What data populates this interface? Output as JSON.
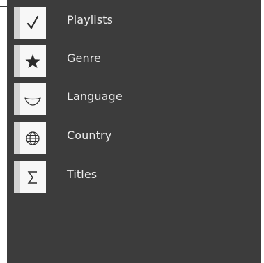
{
  "menu": {
    "items": [
      {
        "label": "Playlists",
        "icon": "checkmark-icon"
      },
      {
        "label": "Genre",
        "icon": "star-icon"
      },
      {
        "label": "Language",
        "icon": "lips-icon"
      },
      {
        "label": "Country",
        "icon": "globe-icon"
      },
      {
        "label": "Titles",
        "icon": "sigma-icon"
      }
    ]
  },
  "colors": {
    "panel_background": "#3c3c3c",
    "tile_background": "#f7f7f7",
    "tile_edge": "#d3d3d3",
    "icon": "#2b2b2b",
    "label_text": "#ececec"
  }
}
